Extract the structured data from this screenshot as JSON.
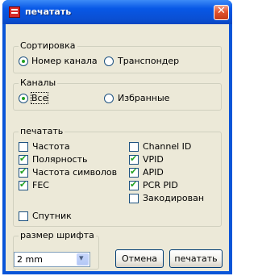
{
  "window": {
    "title": "печатать"
  },
  "sort": {
    "legend": "Сортировка",
    "options": [
      {
        "label": "Номер канала",
        "selected": true
      },
      {
        "label": "Транспондер",
        "selected": false
      }
    ]
  },
  "channels": {
    "legend": "Каналы",
    "options": [
      {
        "label": "Все",
        "selected": true
      },
      {
        "label": "Избранные",
        "selected": false
      }
    ]
  },
  "print_opts": {
    "legend": "печатать",
    "left": [
      {
        "label": "Частота",
        "checked": false
      },
      {
        "label": "Полярность",
        "checked": true
      },
      {
        "label": "Частота символов",
        "checked": true
      },
      {
        "label": "FEC",
        "checked": true
      },
      {
        "label": "Спутник",
        "checked": false
      }
    ],
    "right": [
      {
        "label": "Channel ID",
        "checked": false
      },
      {
        "label": "VPID",
        "checked": true
      },
      {
        "label": "APID",
        "checked": true
      },
      {
        "label": "PCR PID",
        "checked": true
      },
      {
        "label": "Закодирован",
        "checked": false
      }
    ]
  },
  "font_size": {
    "legend": "размер шрифта",
    "value": "2 mm"
  },
  "buttons": {
    "cancel": "Отмена",
    "print": "печатать"
  },
  "colors": {
    "title_bar": "#0a55d8",
    "dialog_bg": "#ece9d8",
    "close": "#e2542e",
    "check": "#21a121"
  }
}
